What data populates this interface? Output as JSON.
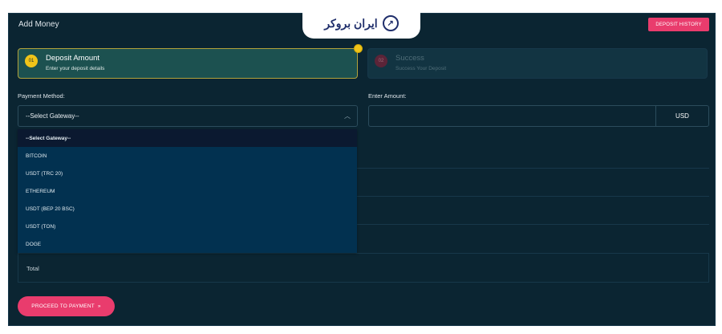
{
  "page": {
    "title": "Add Money",
    "history_button": "DEPOSIT HISTORY"
  },
  "logo": {
    "text": "ایران بروکر",
    "icon": "chart-trend-icon"
  },
  "steps": [
    {
      "num": "01",
      "title": "Deposit Amount",
      "subtitle": "Enter your deposit details",
      "active": true
    },
    {
      "num": "02",
      "title": "Success",
      "subtitle": "Success Your Deposit",
      "active": false
    }
  ],
  "form": {
    "payment_label": "Payment Method:",
    "select_value": "--Select Gateway--",
    "amount_label": "Enter Amount:",
    "amount_value": "",
    "currency": "USD"
  },
  "dropdown": {
    "options": [
      "--Select Gateway--",
      "BITCOIN",
      "USDT (TRC 20)",
      "ETHEREUM",
      "USDT (BEP 20 BSC)",
      "USDT (TON)",
      "DOGE"
    ]
  },
  "summary": {
    "total_label": "Total"
  },
  "actions": {
    "proceed": "PROCEED TO PAYMENT",
    "proceed_icon": "double-chevron-right-icon"
  },
  "colors": {
    "accent": "#e93c6d",
    "highlight": "#f0c419",
    "panel": "#0b2532"
  }
}
